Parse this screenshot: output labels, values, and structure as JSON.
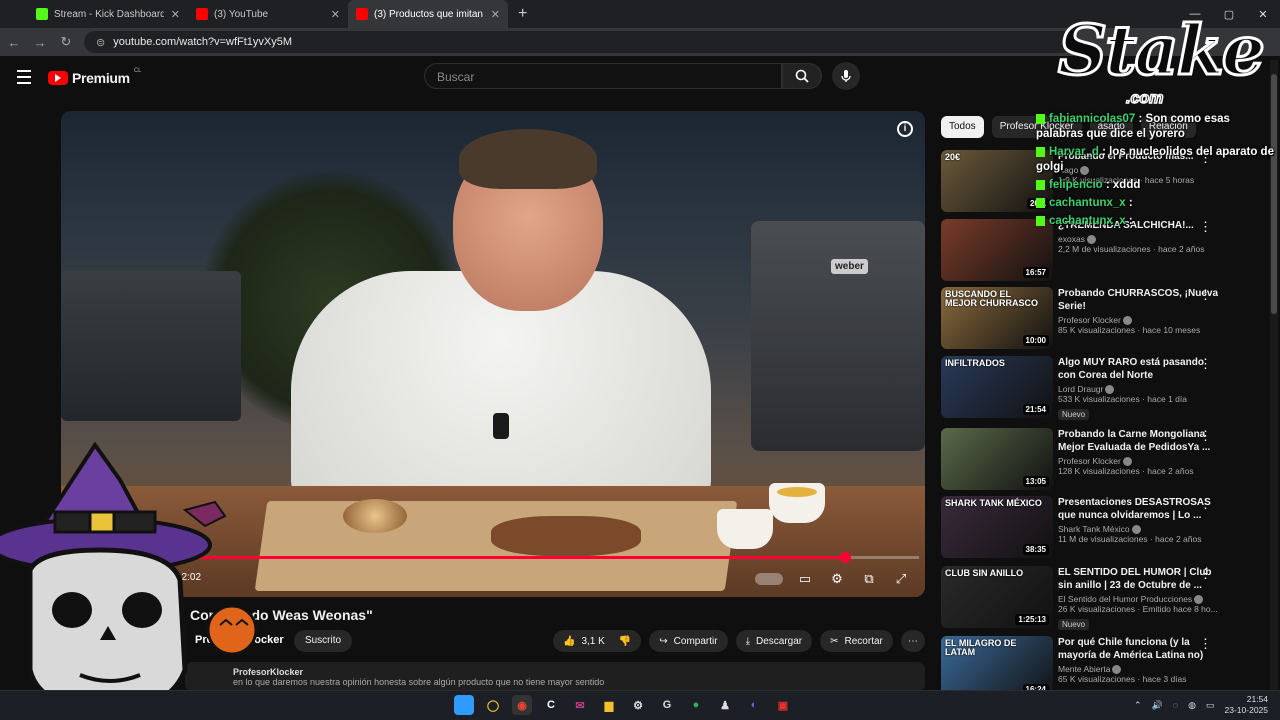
{
  "browser": {
    "tabs": [
      {
        "label": "Stream - Kick Dashboard",
        "color": "#53fc18"
      },
      {
        "label": "(3) YouTube",
        "color": "#ff0000"
      },
      {
        "label": "(3) Productos que imitan Co",
        "color": "#ff0000"
      }
    ],
    "url": "youtube.com/watch?v=wfFt1yvXy5M",
    "new_tab": "+",
    "minimize": "—",
    "maximize": "▢",
    "close": "✕"
  },
  "youtube": {
    "logo_word": "Premium",
    "logo_sup": "CL",
    "search_placeholder": "Buscar"
  },
  "player": {
    "current_time": "12:02",
    "progress": 0.9,
    "grill_brand": "weber",
    "info_icon": "i"
  },
  "video": {
    "title": "Comprando Weas Weonas\"",
    "channel": "Profesor Klocker",
    "subscribe_label": "Suscrito",
    "likes": "3,1 K",
    "share_label": "Compartir",
    "download_label": "Descargar",
    "clip_label": "Recortar",
    "description_channel": "ProfesorKlocker",
    "description_text": "en lo que daremos nuestra opinión honesta sobre algún producto que no tiene mayor sentido"
  },
  "chips": [
    "Todos",
    "Profesor Klocker",
    "asado",
    "Relacion"
  ],
  "recommendations": [
    {
      "thumb_text": "20€",
      "title": "Probando el Producto más...",
      "channel": "Hago",
      "views": "1,9 K visualizaciones · hace 5 horas",
      "duration": "20:1",
      "bg": "#6b5a3a",
      "new": ""
    },
    {
      "thumb_text": "",
      "title": "¿TREMENDA SALCHICHA!...",
      "channel": "exoxas",
      "views": "2,2 M de visualizaciones · hace 2 años",
      "duration": "16:57",
      "bg": "#7a3b2a",
      "new": ""
    },
    {
      "thumb_text": "BUSCANDO EL MEJOR CHURRASCO",
      "title": "Probando CHURRASCOS, ¡Nueva Serie!",
      "channel": "Profesor Klocker",
      "views": "85 K visualizaciones · hace 10 meses",
      "duration": "10:00",
      "bg": "#8a6a3c",
      "new": ""
    },
    {
      "thumb_text": "INFILTRADOS",
      "title": "Algo MUY RARO está pasando con Corea del Norte",
      "channel": "Lord Draugr",
      "views": "533 K visualizaciones · hace 1 día",
      "duration": "21:54",
      "bg": "#2a3a5a",
      "new": "Nuevo"
    },
    {
      "thumb_text": "",
      "title": "Probando la Carne Mongoliana Mejor Evaluada de PedidosYa ...",
      "channel": "Profesor Klocker",
      "views": "128 K visualizaciones · hace 2 años",
      "duration": "13:05",
      "bg": "#5a6a4a",
      "new": ""
    },
    {
      "thumb_text": "SHARK TANK MÉXICO",
      "title": "Presentaciones DESASTROSAS que nunca olvidaremos | Lo ...",
      "channel": "Shark Tank México",
      "views": "11 M de visualizaciones · hace 2 años",
      "duration": "38:35",
      "bg": "#3a2a3a",
      "new": ""
    },
    {
      "thumb_text": "CLUB SIN ANILLO",
      "title": "EL SENTIDO DEL HUMOR | Club sin anillo | 23 de Octubre de ...",
      "channel": "El Sentido del Humor Producciones",
      "views": "26 K visualizaciones · Emitido hace 8 ho...",
      "duration": "1:25:13",
      "bg": "#2a2a2a",
      "new": "Nuevo"
    },
    {
      "thumb_text": "EL MILAGRO DE LATAM",
      "title": "Por qué Chile funciona (y la mayoría de América Latina no)",
      "channel": "Mente Abierta",
      "views": "65 K visualizaciones · hace 3 días",
      "duration": "16:24",
      "bg": "#3a6a9a",
      "new": ""
    }
  ],
  "chat": [
    {
      "user": "fabiannicolas07",
      "msg": ": Son como esas palabras que dice el yorero"
    },
    {
      "user": "Harvar_d",
      "msg": ": los nucleolidos del aparato de golgi"
    },
    {
      "user": "felipencio",
      "msg": ": xddd"
    },
    {
      "user": "cachantunx_x",
      "msg": ":"
    },
    {
      "user": "cachantunx_x",
      "msg": ":"
    }
  ],
  "stake": {
    "word": "Stake",
    "com": ".com"
  },
  "taskbar": {
    "time": "21:54",
    "date": "23-10-2025"
  }
}
